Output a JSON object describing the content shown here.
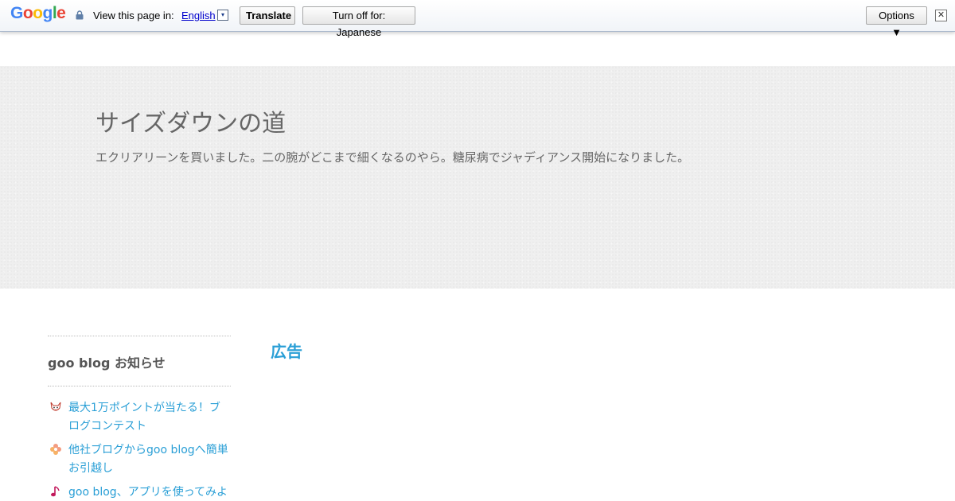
{
  "translate_bar": {
    "logo_letters": [
      {
        "char": "G",
        "color": "#4285f4"
      },
      {
        "char": "o",
        "color": "#ea4335"
      },
      {
        "char": "o",
        "color": "#fbbc05"
      },
      {
        "char": "g",
        "color": "#4285f4"
      },
      {
        "char": "l",
        "color": "#34a853"
      },
      {
        "char": "e",
        "color": "#ea4335"
      }
    ],
    "view_label": "View this page in:",
    "language": "English",
    "language_arrow": "▾",
    "translate_label": "Translate",
    "turn_off_label": "Turn off for: Japanese",
    "options_label": "Options ▼",
    "close_label": "✕"
  },
  "header": {
    "title": "サイズダウンの道",
    "description": "エクリアリーンを買いました。二の腕がどこまで細くなるのやら。糖尿病でジャディアンス開始になりました。"
  },
  "sidebar": {
    "heading": "goo blog お知らせ",
    "items": [
      {
        "label": "最大1万ポイントが当たる！ブログコンテスト",
        "icon": "fox-face-icon"
      },
      {
        "label": "他社ブログからgoo blogへ簡単お引越し",
        "icon": "flower-icon"
      },
      {
        "label": "goo blog、アプリを使ってみよ",
        "icon": "music-note-icon"
      }
    ]
  },
  "main": {
    "ad_heading": "広告"
  },
  "colors": {
    "link": "#2a9fd6",
    "header_bg": "#efefef"
  }
}
